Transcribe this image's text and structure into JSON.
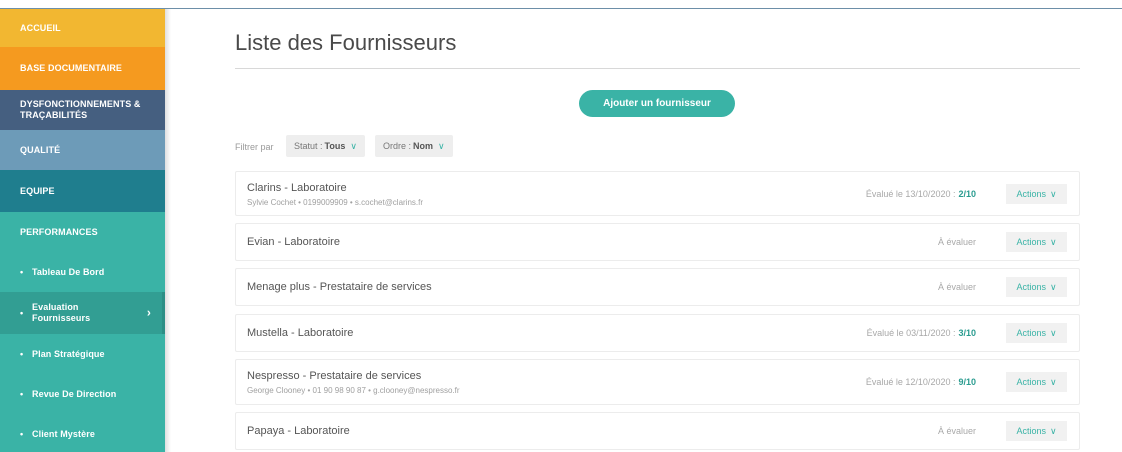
{
  "sidebar": {
    "items": [
      {
        "label": "ACCUEIL",
        "color": "#f2b731"
      },
      {
        "label": "BASE DOCUMENTAIRE",
        "color": "#f59a1f"
      },
      {
        "label": "DYSFONCTIONNEMENTS & TRAÇABILITÉS",
        "color": "#455f80"
      },
      {
        "label": "QUALITÉ",
        "color": "#6d9bb8"
      },
      {
        "label": "EQUIPE",
        "color": "#1f7e8e"
      },
      {
        "label": "PERFORMANCES",
        "color": "#3ab3a6"
      }
    ],
    "subitems": [
      {
        "label": "Tableau De Bord"
      },
      {
        "label": "Evaluation Fournisseurs",
        "active": true
      },
      {
        "label": "Plan Stratégique"
      },
      {
        "label": "Revue De Direction"
      },
      {
        "label": "Client Mystère"
      }
    ],
    "bullet": "•",
    "active_chevron": "›"
  },
  "main": {
    "title": "Liste des Fournisseurs",
    "add_button": "Ajouter un fournisseur",
    "filter_label": "Filtrer par",
    "filters": [
      {
        "prefix": "Statut :",
        "value": "Tous"
      },
      {
        "prefix": "Ordre :",
        "value": "Nom"
      }
    ],
    "chevron": "∨",
    "actions_label": "Actions",
    "suppliers": [
      {
        "name": "Clarins - Laboratoire",
        "contact": "Sylvie Cochet • 0199009909 • s.cochet@clarins.fr",
        "status": "Évalué le 13/10/2020 :",
        "score": "2/10"
      },
      {
        "name": "Evian - Laboratoire",
        "contact": "",
        "status": "À évaluer",
        "score": ""
      },
      {
        "name": "Menage plus - Prestataire de services",
        "contact": "",
        "status": "À évaluer",
        "score": ""
      },
      {
        "name": "Mustella - Laboratoire",
        "contact": "",
        "status": "Évalué le 03/11/2020 :",
        "score": "3/10"
      },
      {
        "name": "Nespresso - Prestataire de services",
        "contact": "George Clooney • 01 90 98 90 87 • g.clooney@nespresso.fr",
        "status": "Évalué le 12/10/2020 :",
        "score": "9/10"
      },
      {
        "name": "Papaya - Laboratoire",
        "contact": "",
        "status": "À évaluer",
        "score": ""
      }
    ]
  }
}
